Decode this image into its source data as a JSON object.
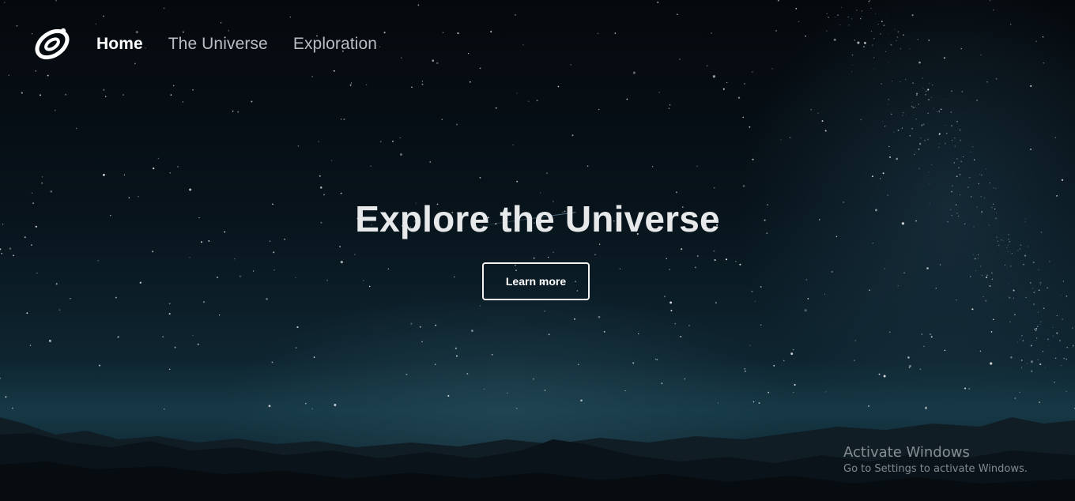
{
  "nav": {
    "logo_icon": "spiral-galaxy-icon",
    "items": [
      {
        "label": "Home",
        "active": true
      },
      {
        "label": "The Universe",
        "active": false
      },
      {
        "label": "Exploration",
        "active": false
      }
    ]
  },
  "hero": {
    "title": "Explore the Universe",
    "button_label": "Learn more"
  },
  "watermark": {
    "title": "Activate Windows",
    "subtitle": "Go to Settings to activate Windows."
  },
  "colors": {
    "sky_top": "#05090d",
    "horizon_glow": "#163846",
    "text_primary": "#ffffff",
    "text_muted": "#b9bec3"
  }
}
